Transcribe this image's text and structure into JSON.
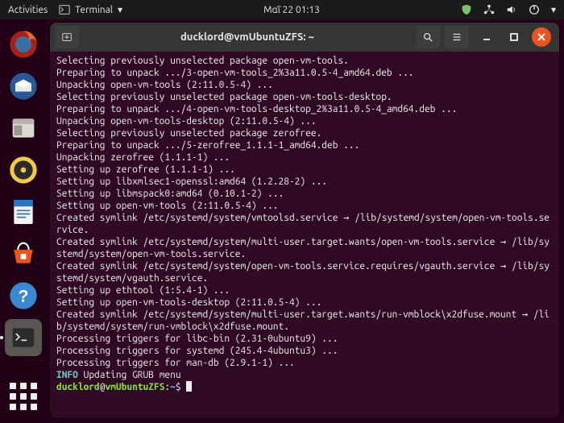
{
  "topbar": {
    "activities": "Activities",
    "app_label": "Terminal",
    "clock": "Μαΐ 22  01:13"
  },
  "window": {
    "title": "ducklord@vmUbuntuZFS: ~"
  },
  "terminal": {
    "lines": [
      "Selecting previously unselected package open-vm-tools.",
      "Preparing to unpack .../3-open-vm-tools_2%3a11.0.5-4_amd64.deb ...",
      "Unpacking open-vm-tools (2:11.0.5-4) ...",
      "Selecting previously unselected package open-vm-tools-desktop.",
      "Preparing to unpack .../4-open-vm-tools-desktop_2%3a11.0.5-4_amd64.deb ...",
      "Unpacking open-vm-tools-desktop (2:11.0.5-4) ...",
      "Selecting previously unselected package zerofree.",
      "Preparing to unpack .../5-zerofree_1.1.1-1_amd64.deb ...",
      "Unpacking zerofree (1.1.1-1) ...",
      "Setting up zerofree (1.1.1-1) ...",
      "Setting up libxmlsec1-openssl:amd64 (1.2.28-2) ...",
      "Setting up libmspack0:amd64 (0.10.1-2) ...",
      "Setting up open-vm-tools (2:11.0.5-4) ...",
      "Created symlink /etc/systemd/system/vmtoolsd.service → /lib/systemd/system/open-vm-tools.service.",
      "Created symlink /etc/systemd/system/multi-user.target.wants/open-vm-tools.service → /lib/systemd/system/open-vm-tools.service.",
      "Created symlink /etc/systemd/system/open-vm-tools.service.requires/vgauth.service → /lib/systemd/system/vgauth.service.",
      "Setting up ethtool (1:5.4-1) ...",
      "Setting up open-vm-tools-desktop (2:11.0.5-4) ...",
      "Created symlink /etc/systemd/system/multi-user.target.wants/run-vmblock\\x2dfuse.mount → /lib/systemd/system/run-vmblock\\x2dfuse.mount.",
      "Processing triggers for libc-bin (2.31-0ubuntu9) ...",
      "Processing triggers for systemd (245.4-4ubuntu3) ...",
      "Processing triggers for man-db (2.9.1-1) ..."
    ],
    "info_prefix": "INFO",
    "info_msg": " Updating GRUB menu",
    "prompt": {
      "user": "ducklord",
      "at": "@",
      "host": "vmUbuntuZFS",
      "colon": ":",
      "path": "~",
      "dollar": "$"
    }
  },
  "dock": {
    "items": [
      "firefox",
      "thunderbird",
      "files",
      "rhythmbox",
      "writer",
      "software",
      "help",
      "terminal"
    ]
  }
}
